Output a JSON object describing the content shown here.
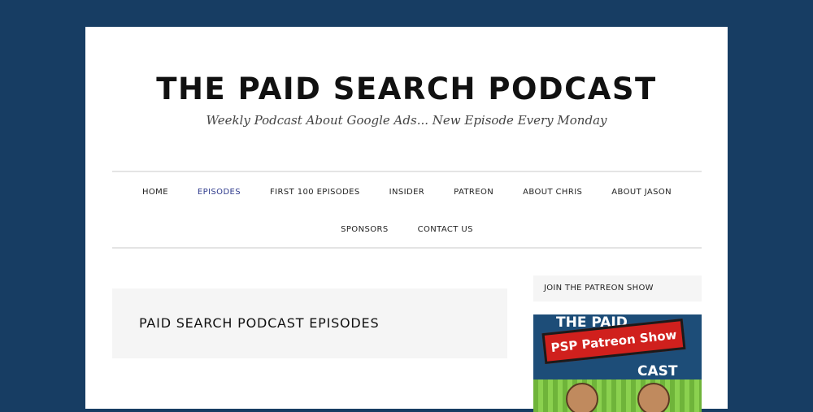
{
  "site": {
    "title": "THE PAID SEARCH PODCAST",
    "tagline": "Weekly Podcast About Google Ads... New Episode Every Monday"
  },
  "nav": {
    "row1": [
      "HOME",
      "EPISODES",
      "FIRST 100 EPISODES",
      "INSIDER",
      "PATREON",
      "ABOUT CHRIS",
      "ABOUT JASON"
    ],
    "row2": [
      "SPONSORS",
      "CONTACT US"
    ],
    "active": "EPISODES",
    "active_color": "#2e3a8c"
  },
  "content": {
    "title": "PAID SEARCH PODCAST EPISODES"
  },
  "sidebar": {
    "widget_title": "JOIN THE PATREON SHOW",
    "promo": {
      "top_text": "THE PAID",
      "bottom_text": "CAST",
      "banner_text": "PSP Patreon Show"
    }
  },
  "colors": {
    "background": "#173d63",
    "page": "#ffffff",
    "box": "#f5f5f5"
  }
}
